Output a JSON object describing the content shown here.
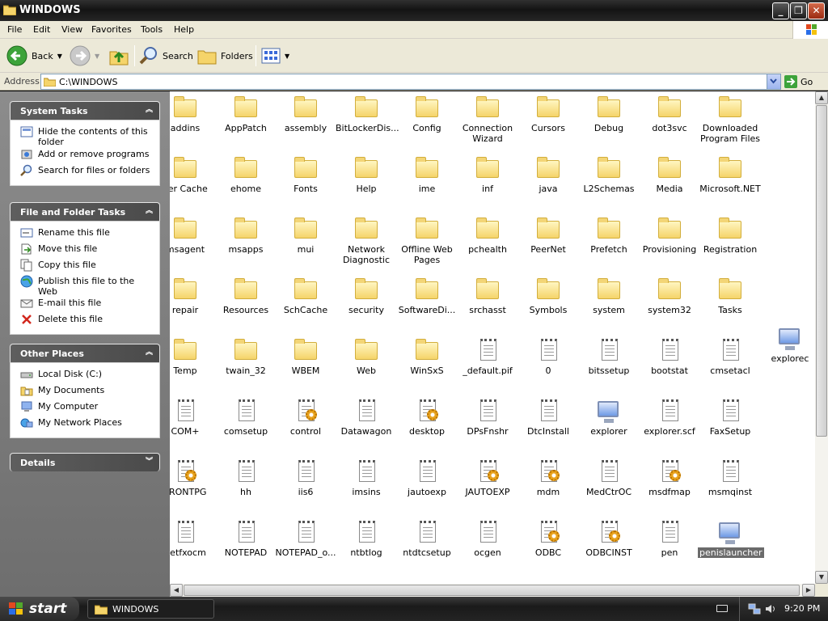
{
  "window": {
    "title": "WINDOWS"
  },
  "menubar": {
    "items": [
      "File",
      "Edit",
      "View",
      "Favorites",
      "Tools",
      "Help"
    ]
  },
  "toolbar": {
    "back_label": "Back",
    "search_label": "Search",
    "folders_label": "Folders"
  },
  "address": {
    "label": "Address",
    "value": "C:\\WINDOWS",
    "go_label": "Go"
  },
  "taskpane": {
    "system_tasks": {
      "title": "System Tasks",
      "items": [
        "Hide the contents of this folder",
        "Add or remove programs",
        "Search for files or folders"
      ]
    },
    "file_tasks": {
      "title": "File and Folder Tasks",
      "items": [
        "Rename this file",
        "Move this file",
        "Copy this file",
        "Publish this file to the Web",
        "E-mail this file",
        "Delete this file"
      ]
    },
    "other_places": {
      "title": "Other Places",
      "items": [
        "Local Disk (C:)",
        "My Documents",
        "My Computer",
        "My Network Places"
      ]
    },
    "details": {
      "title": "Details"
    }
  },
  "files": {
    "rows": [
      [
        "addins",
        "AppPatch",
        "assembly",
        "BitLockerDis...",
        "Config",
        "Connection Wizard",
        "Cursors",
        "Debug",
        "dot3svc",
        "Downloaded Program Files"
      ],
      [
        "ver Cache",
        "ehome",
        "Fonts",
        "Help",
        "ime",
        "inf",
        "java",
        "L2Schemas",
        "Media",
        "Microsoft.NET"
      ],
      [
        "msagent",
        "msapps",
        "mui",
        "Network Diagnostic",
        "Offline Web Pages",
        "pchealth",
        "PeerNet",
        "Prefetch",
        "Provisioning",
        "Registration"
      ],
      [
        "repair",
        "Resources",
        "SchCache",
        "security",
        "SoftwareDi...",
        "srchasst",
        "Symbols",
        "system",
        "system32",
        "Tasks"
      ],
      [
        "Temp",
        "twain_32",
        "WBEM",
        "Web",
        "WinSxS",
        "_default.pif",
        "0",
        "bitssetup",
        "bootstat",
        "cmsetacl"
      ],
      [
        "COM+",
        "comsetup",
        "control",
        "Datawagon",
        "desktop",
        "DPsFnshr",
        "DtcInstall",
        "explorer",
        "explorer.scf",
        "FaxSetup"
      ],
      [
        "FRONTPG",
        "hh",
        "iis6",
        "imsins",
        "jautoexp",
        "JAUTOEXP",
        "mdm",
        "MedCtrOC",
        "msdfmap",
        "msmqinst"
      ],
      [
        "netfxocm",
        "NOTEPAD",
        "NOTEPAD_o...",
        "ntbtlog",
        "ntdtcsetup",
        "ocgen",
        "ODBC",
        "ODBCINST",
        "pen",
        "penislauncher"
      ]
    ],
    "extra": "explorec",
    "selected": "penislauncher"
  },
  "taskbar": {
    "start_label": "start",
    "window_label": "WINDOWS",
    "clock": "9:20 PM"
  }
}
